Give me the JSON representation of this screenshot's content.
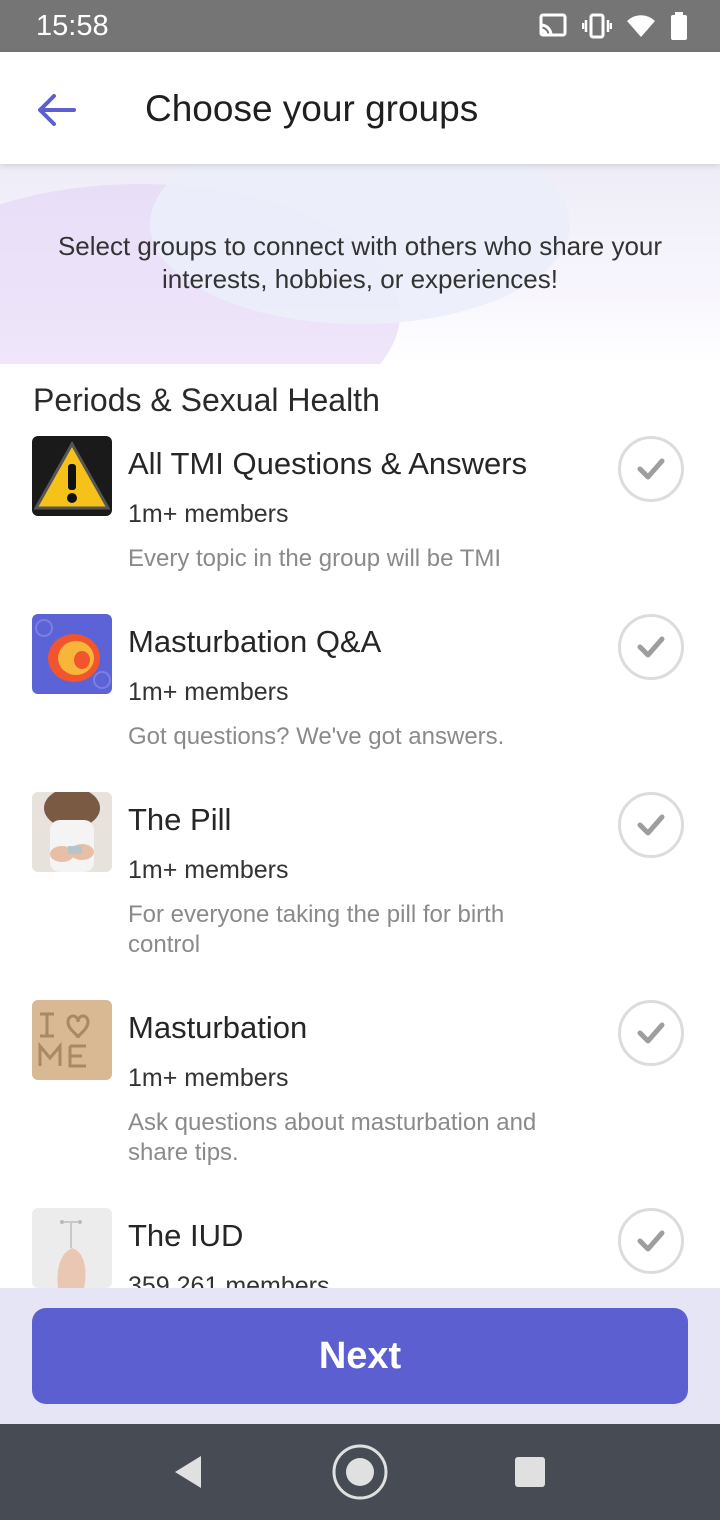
{
  "status_bar": {
    "time": "15:58",
    "icons": [
      "cast-icon",
      "vibrate-icon",
      "wifi-icon",
      "battery-icon"
    ]
  },
  "header": {
    "title": "Choose your groups",
    "back_icon": "arrow-left-icon"
  },
  "intro": {
    "text": "Select groups to connect with others who share your interests, hobbies, or experiences!"
  },
  "section": {
    "title": "Periods & Sexual Health"
  },
  "groups": [
    {
      "name": "All TMI Questions & Answers",
      "members": "1m+ members",
      "description": "Every topic in the group will be TMI",
      "selected": false
    },
    {
      "name": "Masturbation Q&A",
      "members": "1m+ members",
      "description": "Got questions? We've got answers.",
      "selected": false
    },
    {
      "name": "The Pill",
      "members": "1m+ members",
      "description": "For everyone taking the pill for birth control",
      "selected": false
    },
    {
      "name": "Masturbation",
      "members": "1m+ members",
      "description": "Ask questions about masturbation and share tips.",
      "selected": false
    },
    {
      "name": "The IUD",
      "members": "359,261 members",
      "description": "",
      "selected": false
    }
  ],
  "footer": {
    "next_label": "Next"
  },
  "nav": [
    "back-triangle-icon",
    "home-circle-icon",
    "recents-square-icon"
  ],
  "colors": {
    "accent": "#5b5fcf",
    "back_arrow": "#5b5fcf",
    "check_border": "#dcdcdc",
    "check_mark": "#9e9e9e"
  }
}
